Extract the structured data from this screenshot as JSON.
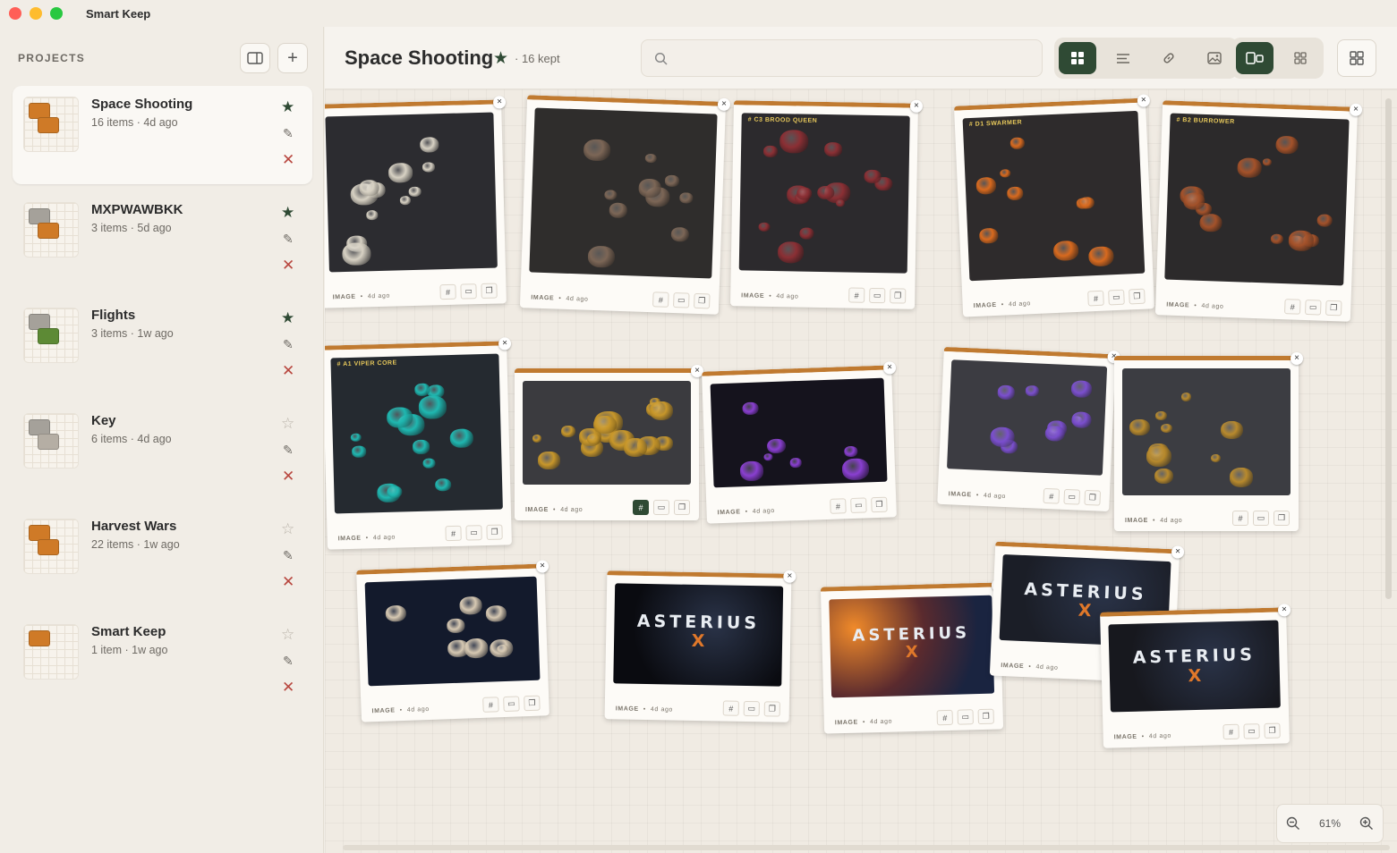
{
  "app": {
    "title": "Smart Keep"
  },
  "sidebar": {
    "heading": "PROJECTS",
    "projects": [
      {
        "name": "Space Shooting",
        "meta": "16 items · 4d ago",
        "starred": true,
        "colors": [
          "#cf7a27",
          "#cf7a27"
        ]
      },
      {
        "name": "MXPWAWBKK",
        "meta": "3 items · 5d ago",
        "starred": true,
        "colors": [
          "#a5a19a",
          "#cf7a27"
        ]
      },
      {
        "name": "Flights",
        "meta": "3 items · 1w ago",
        "starred": true,
        "colors": [
          "#a5a19a",
          "#5d8a35"
        ]
      },
      {
        "name": "Key",
        "meta": "6 items · 4d ago",
        "starred": false,
        "colors": [
          "#a5a19a",
          "#b5aea4"
        ]
      },
      {
        "name": "Harvest Wars",
        "meta": "22 items · 1w ago",
        "starred": false,
        "colors": [
          "#cf7a27",
          "#cf7a27"
        ]
      },
      {
        "name": "Smart Keep",
        "meta": "1 item · 1w ago",
        "starred": false,
        "colors": [
          "#cf7a27"
        ]
      }
    ]
  },
  "header": {
    "title": "Space Shooting",
    "count": "· 16 kept",
    "search_placeholder": ""
  },
  "cards": [
    {
      "label": "",
      "foot": "IMAGE",
      "time": "4d ago",
      "theme": "asteroids-white"
    },
    {
      "label": "",
      "foot": "IMAGE",
      "time": "4d ago",
      "theme": "asteroids-brown"
    },
    {
      "label": "# C3 BROOD QUEEN",
      "foot": "IMAGE",
      "time": "4d ago",
      "theme": "brood"
    },
    {
      "label": "# D1 SWARMER",
      "foot": "IMAGE",
      "time": "4d ago",
      "theme": "swarmer"
    },
    {
      "label": "# B2 BURROWER",
      "foot": "IMAGE",
      "time": "4d ago",
      "theme": "burrower"
    },
    {
      "label": "# A1 VIPER CORE",
      "foot": "IMAGE",
      "time": "4d ago",
      "theme": "viper"
    },
    {
      "label": "",
      "foot": "IMAGE",
      "time": "4d ago",
      "theme": "bees"
    },
    {
      "label": "",
      "foot": "IMAGE",
      "time": "4d ago",
      "theme": "purple-ships"
    },
    {
      "label": "",
      "foot": "IMAGE",
      "time": "4d ago",
      "theme": "purple-bugs"
    },
    {
      "label": "",
      "foot": "IMAGE",
      "time": "4d ago",
      "theme": "gold-bugs"
    },
    {
      "label": "",
      "foot": "IMAGE",
      "time": "4d ago",
      "theme": "space-robots"
    },
    {
      "label": "ASTERIUS",
      "sublabel": "X",
      "foot": "IMAGE",
      "time": "4d ago",
      "theme": "logo-dark"
    },
    {
      "label": "ASTERIUS",
      "sublabel": "X",
      "foot": "IMAGE",
      "time": "4d ago",
      "theme": "logo-fire"
    },
    {
      "label": "ASTERIUS",
      "sublabel": "X",
      "foot": "IMAGE",
      "time": "4d ago",
      "theme": "logo-ship"
    },
    {
      "label": "ASTERIUS",
      "sublabel": "X",
      "foot": "IMAGE",
      "time": "4d ago",
      "theme": "logo-ship2"
    }
  ],
  "zoom": {
    "level": "61%"
  },
  "colors": {
    "accent": "#2f4a34",
    "card_top": "#c07a30",
    "delete": "#b8463e"
  }
}
